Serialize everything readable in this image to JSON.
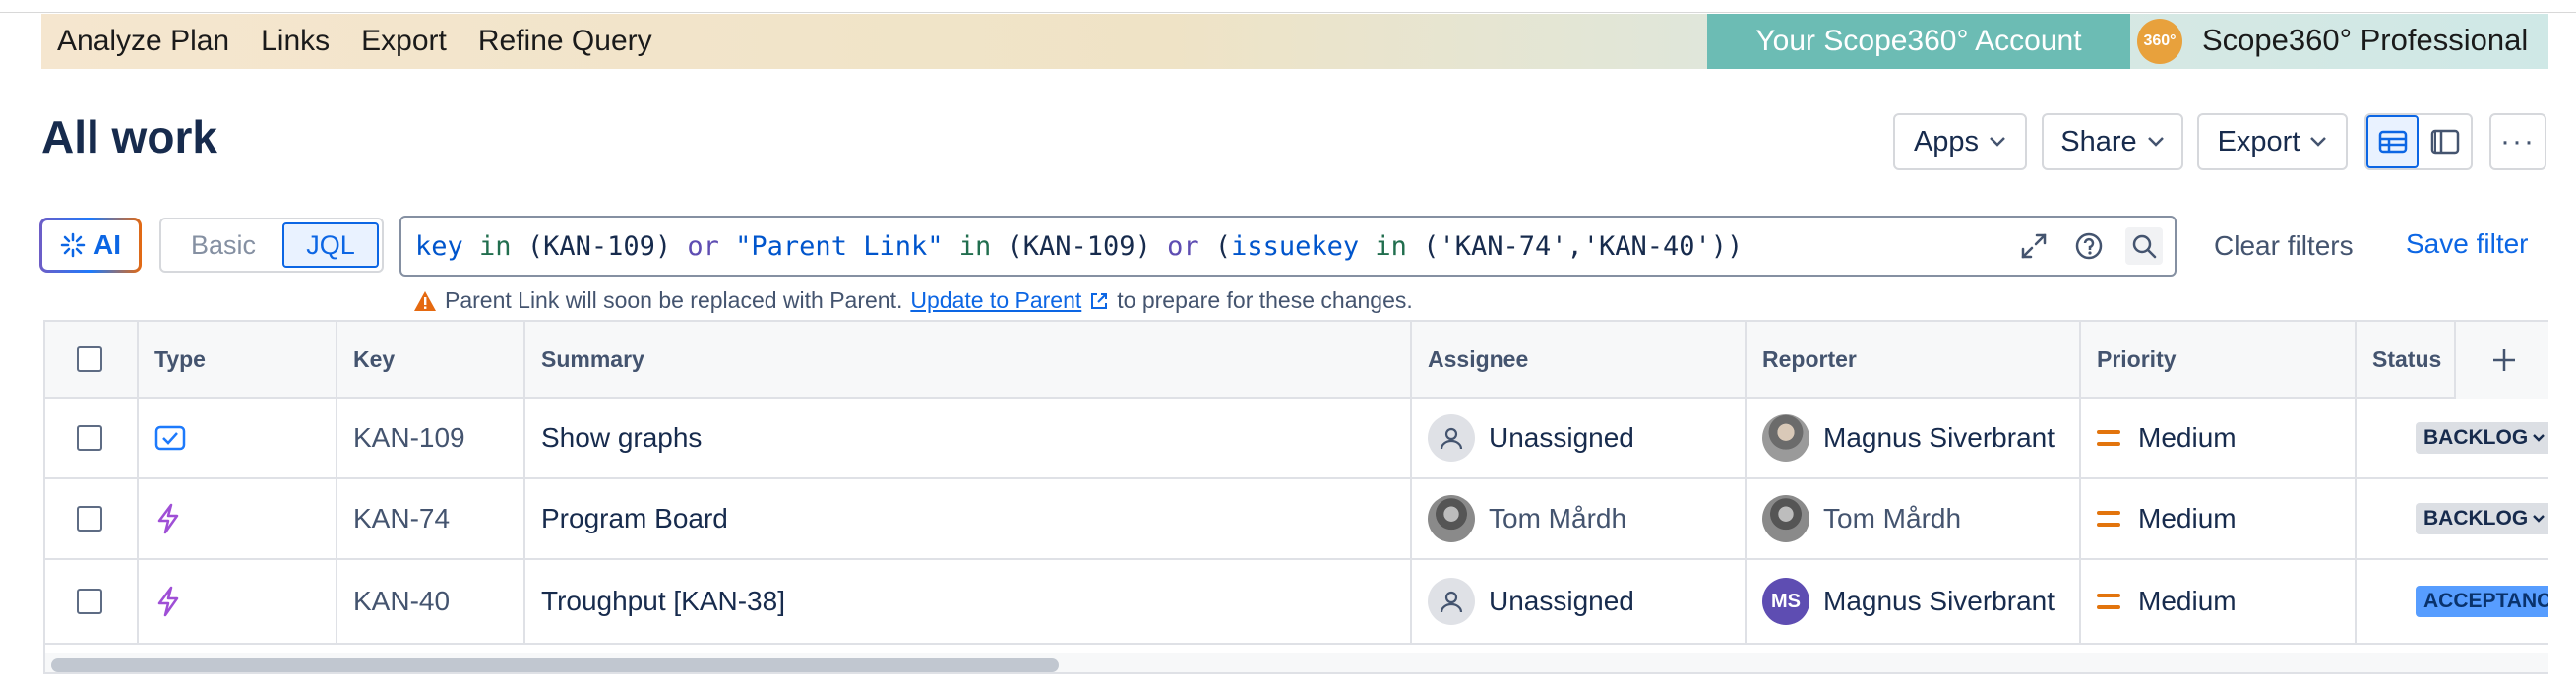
{
  "addon_bar": {
    "menu": [
      "Analyze Plan",
      "Links",
      "Export",
      "Refine Query"
    ],
    "kebab": "⋮",
    "account_button": "Your Scope360° Account",
    "badge": "360°",
    "product": "Scope360° Professional"
  },
  "header": {
    "title": "All work",
    "buttons": {
      "apps": "Apps",
      "share": "Share",
      "export": "Export"
    },
    "more": "···"
  },
  "filter": {
    "ai_label": "AI",
    "mode_basic": "Basic",
    "mode_jql": "JQL",
    "query_tokens": [
      [
        "fld",
        "key"
      ],
      [
        "txt",
        " "
      ],
      [
        "op",
        "in"
      ],
      [
        "txt",
        " (KAN-109) "
      ],
      [
        "kw",
        "or"
      ],
      [
        "txt",
        " "
      ],
      [
        "str",
        "\"Parent Link\""
      ],
      [
        "txt",
        " "
      ],
      [
        "op",
        "in"
      ],
      [
        "txt",
        " (KAN-109) "
      ],
      [
        "kw",
        "or"
      ],
      [
        "txt",
        " ("
      ],
      [
        "fld",
        "issuekey"
      ],
      [
        "txt",
        " "
      ],
      [
        "op",
        "in"
      ],
      [
        "txt",
        " ('KAN-74','KAN-40'))"
      ]
    ],
    "clear_filters": "Clear filters",
    "save_filter": "Save filter",
    "warning_text": "Parent Link will soon be replaced with Parent.",
    "warning_link": "Update to Parent",
    "warning_suffix": "to prepare for these changes."
  },
  "table": {
    "columns": [
      "Type",
      "Key",
      "Summary",
      "Assignee",
      "Reporter",
      "Priority",
      "Status"
    ],
    "rows": [
      {
        "type_icon": "task-icon",
        "key": "KAN-109",
        "summary": "Show graphs",
        "assignee": "Unassigned",
        "assignee_avatar": "unassigned",
        "reporter": "Magnus Siverbrant",
        "reporter_avatar": "photo",
        "priority": "Medium",
        "status": "BACKLOG",
        "status_style": "backlog"
      },
      {
        "type_icon": "epic-icon",
        "key": "KAN-74",
        "summary": "Program Board",
        "assignee": "Tom Mårdh",
        "assignee_avatar": "photo2",
        "reporter": "Tom Mårdh",
        "reporter_avatar": "photo2",
        "priority": "Medium",
        "status": "BACKLOG",
        "status_style": "backlog"
      },
      {
        "type_icon": "epic-icon",
        "key": "KAN-40",
        "summary": "Troughput [KAN-38]",
        "assignee": "Unassigned",
        "assignee_avatar": "unassigned",
        "reporter": "Magnus Siverbrant",
        "reporter_avatar": "initials",
        "reporter_initials": "MS",
        "priority": "Medium",
        "status": "ACCEPTANCE",
        "status_style": "acceptance"
      }
    ]
  },
  "colors": {
    "accent": "#0c66e4",
    "account_button": "#6cbcb4",
    "epic_purple": "#9f4fd6",
    "priority_medium": "#e2740d"
  }
}
